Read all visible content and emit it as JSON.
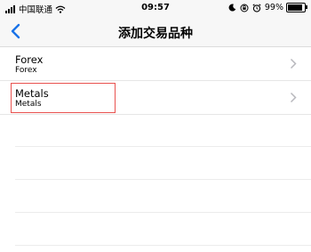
{
  "status_bar": {
    "carrier": "中国联通",
    "time": "09:57",
    "battery": "99%",
    "icons": [
      "signal-icon",
      "wifi-icon",
      "moon-icon",
      "lock-rotation-icon",
      "alarm-icon",
      "battery-icon"
    ]
  },
  "nav": {
    "title": "添加交易品种",
    "back_icon": "chevron-left-icon",
    "accent_color": "#1a73e8"
  },
  "list": {
    "items": [
      {
        "label": "Forex",
        "sublabel": "Forex"
      },
      {
        "label": "Metals",
        "sublabel": "Metals"
      }
    ],
    "highlight_color": "#e8524f"
  }
}
